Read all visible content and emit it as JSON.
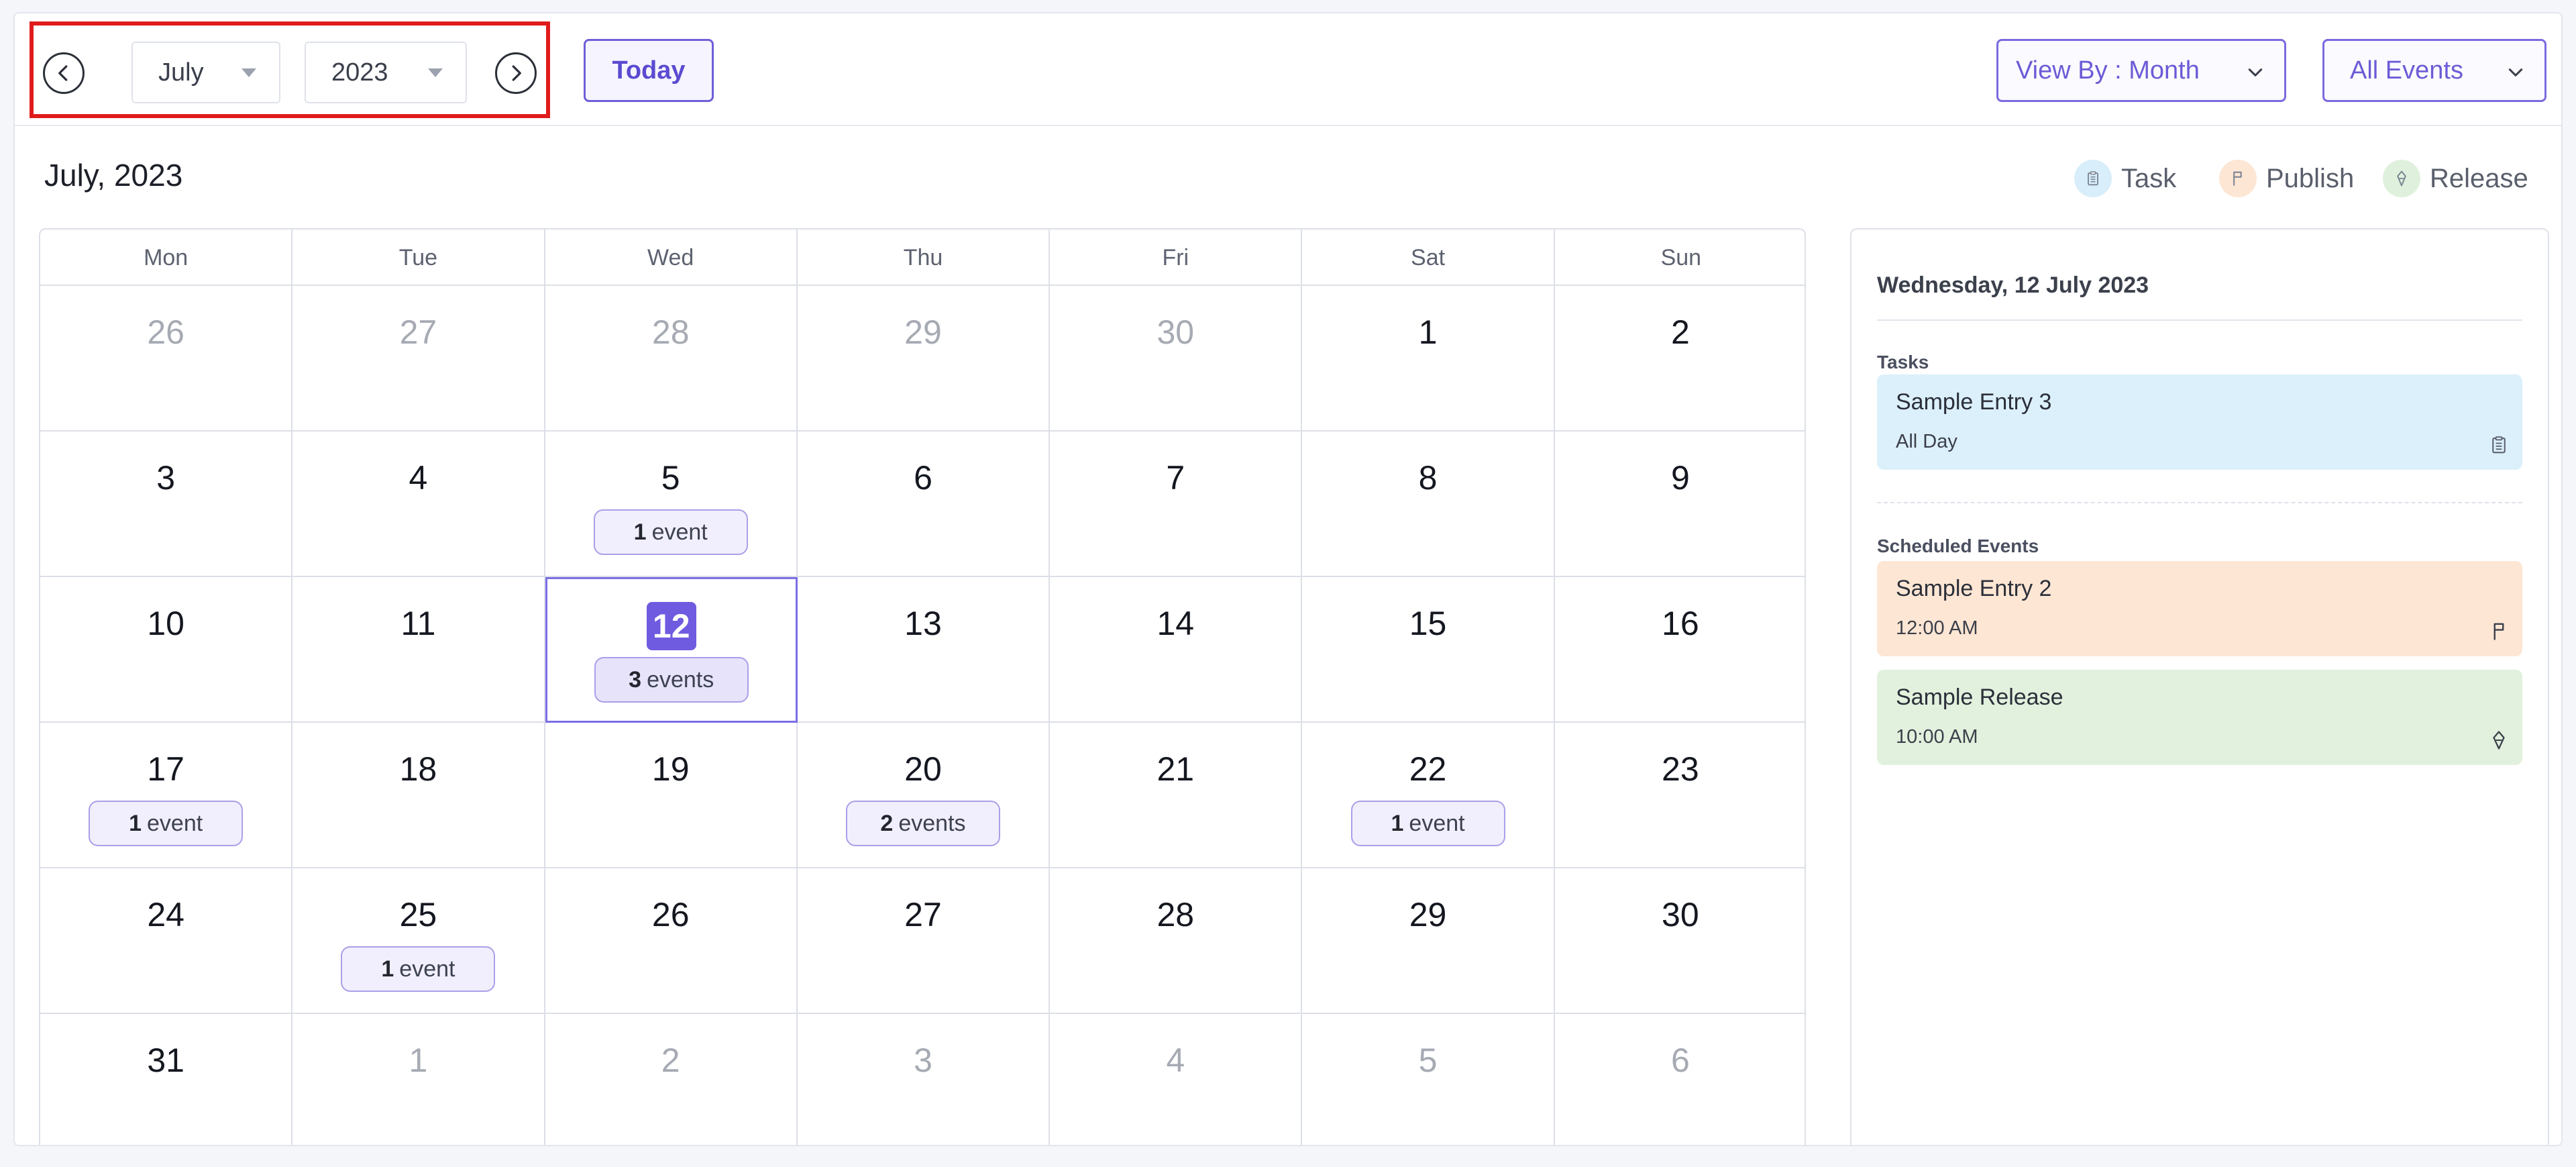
{
  "toolbar": {
    "month_value": "July",
    "year_value": "2023",
    "today_label": "Today",
    "view_by_label": "View By : Month",
    "filter_label": "All Events"
  },
  "heading": "July, 2023",
  "legend": [
    {
      "label": "Task",
      "color": "#d8eefa",
      "icon": "clipboard-icon"
    },
    {
      "label": "Publish",
      "color": "#fde6d4",
      "icon": "flag-icon"
    },
    {
      "label": "Release",
      "color": "#dff1dc",
      "icon": "rocket-icon"
    }
  ],
  "weekdays": [
    "Mon",
    "Tue",
    "Wed",
    "Thu",
    "Fri",
    "Sat",
    "Sun"
  ],
  "weeks": [
    [
      {
        "d": "26",
        "m": true
      },
      {
        "d": "27",
        "m": true
      },
      {
        "d": "28",
        "m": true
      },
      {
        "d": "29",
        "m": true
      },
      {
        "d": "30",
        "m": true
      },
      {
        "d": "1"
      },
      {
        "d": "2"
      }
    ],
    [
      {
        "d": "3"
      },
      {
        "d": "4"
      },
      {
        "d": "5",
        "n": "1",
        "t": "event"
      },
      {
        "d": "6"
      },
      {
        "d": "7"
      },
      {
        "d": "8"
      },
      {
        "d": "9"
      }
    ],
    [
      {
        "d": "10"
      },
      {
        "d": "11"
      },
      {
        "d": "12",
        "n": "3",
        "t": "events",
        "sel": true
      },
      {
        "d": "13"
      },
      {
        "d": "14"
      },
      {
        "d": "15"
      },
      {
        "d": "16"
      }
    ],
    [
      {
        "d": "17",
        "n": "1",
        "t": "event"
      },
      {
        "d": "18"
      },
      {
        "d": "19"
      },
      {
        "d": "20",
        "n": "2",
        "t": "events"
      },
      {
        "d": "21"
      },
      {
        "d": "22",
        "n": "1",
        "t": "event"
      },
      {
        "d": "23"
      }
    ],
    [
      {
        "d": "24"
      },
      {
        "d": "25",
        "n": "1",
        "t": "event"
      },
      {
        "d": "26"
      },
      {
        "d": "27"
      },
      {
        "d": "28"
      },
      {
        "d": "29"
      },
      {
        "d": "30"
      }
    ],
    [
      {
        "d": "31"
      },
      {
        "d": "1",
        "m": true
      },
      {
        "d": "2",
        "m": true
      },
      {
        "d": "3",
        "m": true
      },
      {
        "d": "4",
        "m": true
      },
      {
        "d": "5",
        "m": true
      },
      {
        "d": "6",
        "m": true
      }
    ]
  ],
  "panel": {
    "date": "Wednesday, 12 July 2023",
    "tasks_title": "Tasks",
    "tasks": [
      {
        "title": "Sample Entry 3",
        "time": "All Day",
        "color": "#dcf0fb",
        "icon": "clipboard-icon"
      }
    ],
    "events_title": "Scheduled Events",
    "events": [
      {
        "title": "Sample Entry 2",
        "time": "12:00 AM",
        "color": "#fde6d4",
        "icon": "flag-icon"
      },
      {
        "title": "Sample Release",
        "time": "10:00 AM",
        "color": "#e2f1dd",
        "icon": "rocket-icon"
      }
    ]
  }
}
